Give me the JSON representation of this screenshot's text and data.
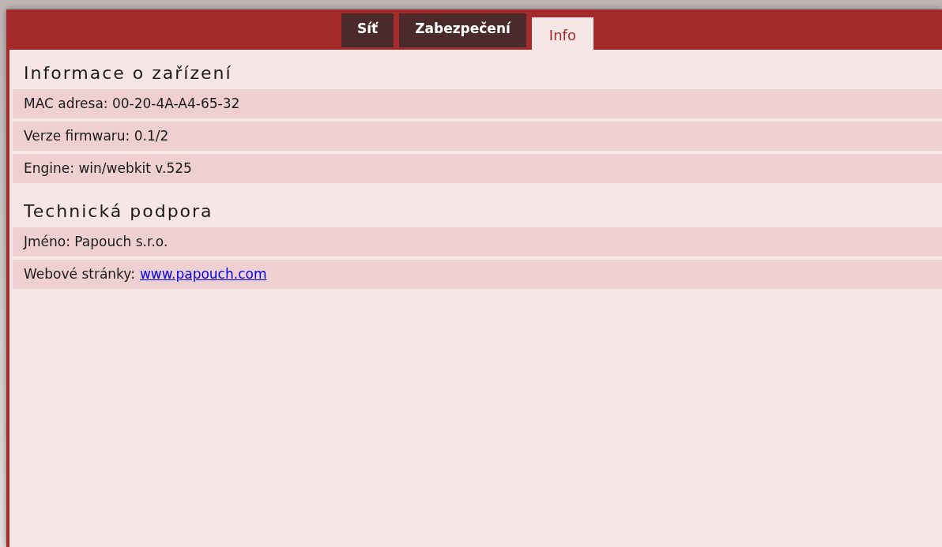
{
  "tabs": [
    {
      "label": "Síť",
      "selected": false
    },
    {
      "label": "Zabezpečení",
      "selected": false
    },
    {
      "label": "Info",
      "selected": true
    }
  ],
  "sections": [
    {
      "title": "Informace o zařízení",
      "rows": [
        {
          "kind": "text",
          "text": "MAC adresa: 00-20-4A-A4-65-32"
        },
        {
          "kind": "text",
          "text": "Verze firmwaru: 0.1/2"
        },
        {
          "kind": "text",
          "text": "Engine: win/webkit v.525"
        }
      ]
    },
    {
      "title": "Technická podpora",
      "rows": [
        {
          "kind": "text",
          "text": "Jméno: Papouch s.r.o."
        },
        {
          "kind": "link",
          "label": "Webové stránky:",
          "link": "www.papouch.com"
        }
      ]
    }
  ]
}
